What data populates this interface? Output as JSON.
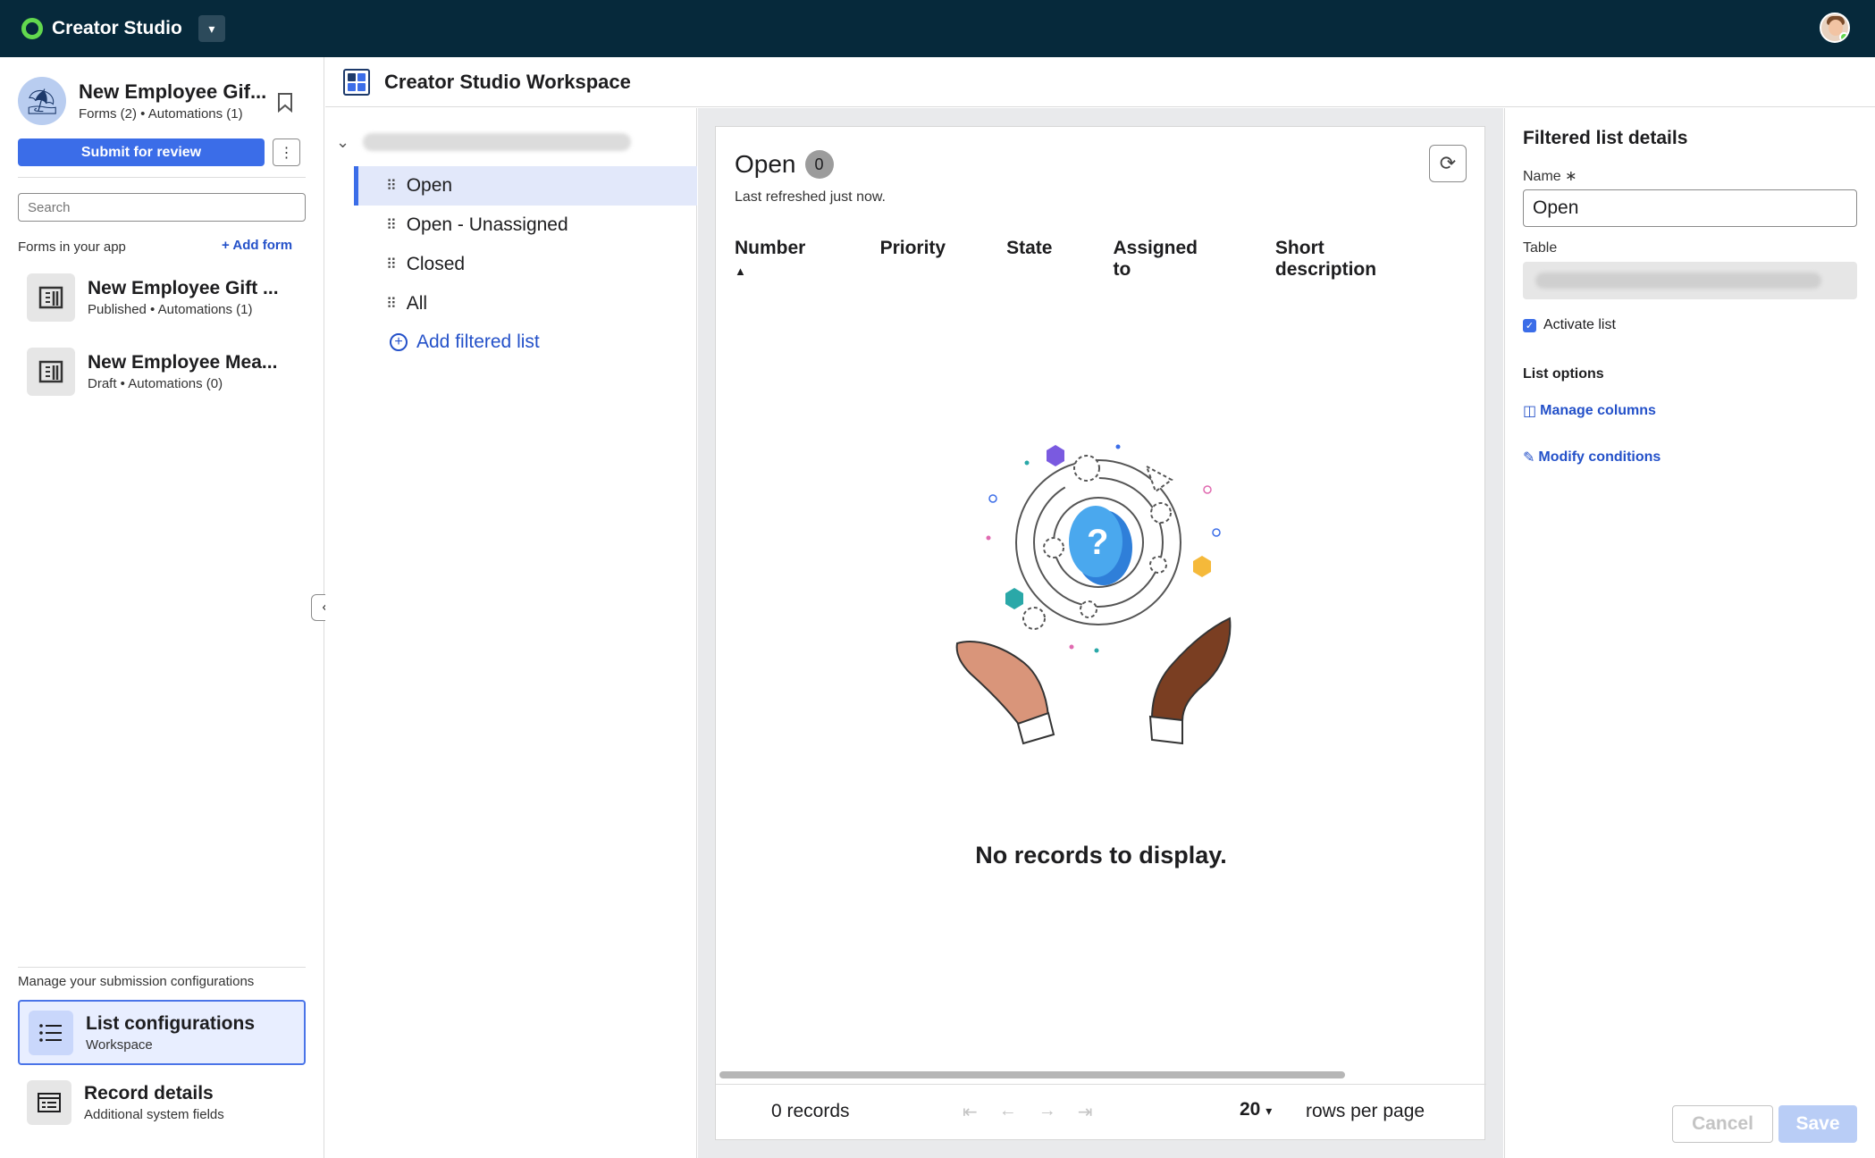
{
  "topbar": {
    "brand": "Creator Studio",
    "dropdown_icon": "caret-down-icon",
    "user_avatar": "user-avatar-icon"
  },
  "app": {
    "name": "New Employee Gif...",
    "subtitle": "Forms (2) • Automations (1)",
    "avatar_icon": "beach-umbrella-icon",
    "bookmark_icon": "bookmark-icon",
    "submit_label": "Submit for review",
    "more_label": "⋮"
  },
  "sidebar": {
    "search_placeholder": "Search",
    "forms_label": "Forms in your app",
    "add_form_label": "+ Add form",
    "forms": [
      {
        "title": "New Employee Gift ...",
        "subtitle": "Published • Automations (1)",
        "icon": "form-icon"
      },
      {
        "title": "New Employee Mea...",
        "subtitle": "Draft • Automations (0)",
        "icon": "form-icon"
      }
    ],
    "manage_label": "Manage your submission configurations",
    "nav": [
      {
        "title": "List configurations",
        "subtitle": "Workspace",
        "icon": "list-icon",
        "active": true
      },
      {
        "title": "Record details",
        "subtitle": "Additional system fields",
        "icon": "record-icon",
        "active": false
      }
    ]
  },
  "workspace": {
    "title": "Creator Studio Workspace",
    "icon": "workspace-icon"
  },
  "tree": {
    "items": [
      {
        "label": "Open",
        "active": true
      },
      {
        "label": "Open - Unassigned",
        "active": false
      },
      {
        "label": "Closed",
        "active": false
      },
      {
        "label": "All",
        "active": false
      }
    ],
    "add_label": "Add filtered list"
  },
  "preview": {
    "title": "Open",
    "count": "0",
    "refreshed": "Last refreshed just now.",
    "columns": [
      "Number",
      "Priority",
      "State",
      "Assigned to",
      "Short description"
    ],
    "sort_indicator": "▲",
    "empty_message": "No records to display.",
    "records": "0 records",
    "rows_per_page": "20",
    "rows_per_page_label": "rows per page"
  },
  "details": {
    "title": "Filtered list details",
    "name_label": "Name",
    "name_required": "∗",
    "name_value": "Open",
    "table_label": "Table",
    "activate_label": "Activate list",
    "list_options_label": "List options",
    "manage_columns": "Manage columns",
    "modify_conditions": "Modify conditions",
    "cancel": "Cancel",
    "save": "Save"
  }
}
